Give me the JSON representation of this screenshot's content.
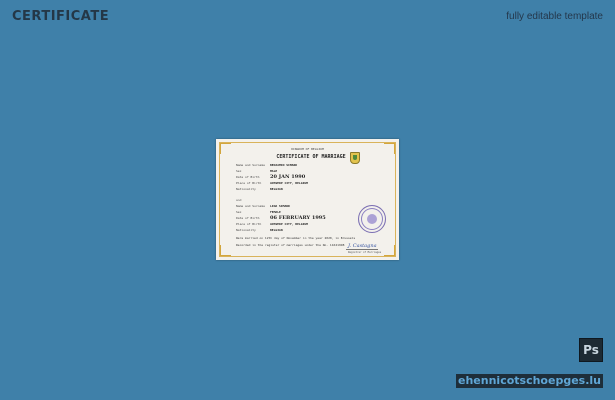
{
  "header": {
    "title": "CERTIFICATE",
    "subtitle": "fully editable template"
  },
  "certificate": {
    "country": "KINGDOM OF BELGIUM",
    "heading": "CERTIFICATE OF MARRIAGE",
    "person1": [
      {
        "label": "Name and Surname",
        "value": "BENJAMIN SIMARD"
      },
      {
        "label": "Sex",
        "value": "MALE"
      },
      {
        "label": "Date of Birth",
        "value": "20 JAN 1990"
      },
      {
        "label": "Place of Birth",
        "value": "ANTWERP CITY, BELGIUM"
      },
      {
        "label": "Nationality",
        "value": "BELGIAN"
      }
    ],
    "and_text": "and",
    "person2": [
      {
        "label": "Name and Surname",
        "value": "LINA SIMARD"
      },
      {
        "label": "Sex",
        "value": "FEMALE"
      },
      {
        "label": "Date of Birth",
        "value": "06 FEBRUARY 1995"
      },
      {
        "label": "Place of Birth",
        "value": "ANTWERP CITY, BELGIUM"
      },
      {
        "label": "Nationality",
        "value": "BELGIAN"
      }
    ],
    "married_line": "Were married on 12th day of November in the year 2020, in Brussels",
    "registry_line": "Recorded in the register of marriages under the No. 11621998",
    "signature": "J. Castagna",
    "registrar_label": "Registrar of Marriages"
  },
  "badges": {
    "ps_label": "Ps",
    "site": "ehennicotschoepges.lu"
  },
  "colors": {
    "background": "#3f80a9",
    "title": "#243747",
    "site_text": "#5fa6d6"
  },
  "icons": {
    "photoshop": "photoshop-icon",
    "crest": "coat-of-arms-icon",
    "stamp": "official-seal-icon"
  }
}
